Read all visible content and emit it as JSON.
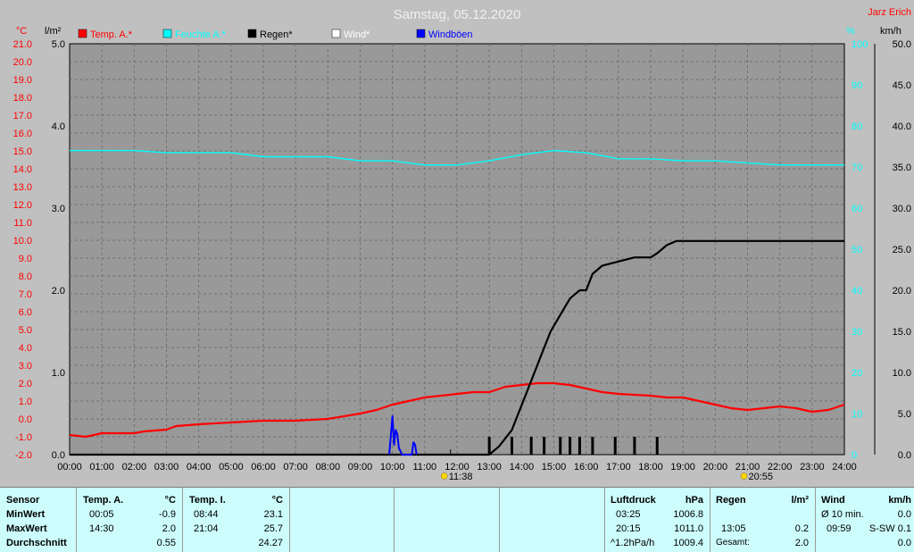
{
  "title": "Samstag, 05.12.2020",
  "author": "Jarz Erich",
  "legend": [
    {
      "label": "Temp. A.*",
      "color": "#ff0000"
    },
    {
      "label": "Feuchte A.*",
      "color": "#00ffff"
    },
    {
      "label": "Regen*",
      "color": "#000000"
    },
    {
      "label": "Wind*",
      "color": "#ffffff"
    },
    {
      "label": "Windböen",
      "color": "#0000ff"
    }
  ],
  "axes": {
    "temp_unit": "°C",
    "rain_unit": "l/m²",
    "hum_unit": "%",
    "wind_unit": "km/h",
    "temp_ticks": [
      "21.0",
      "20.0",
      "19.0",
      "18.0",
      "17.0",
      "16.0",
      "15.0",
      "14.0",
      "13.0",
      "12.0",
      "11.0",
      "10.0",
      "9.0",
      "8.0",
      "7.0",
      "6.0",
      "5.0",
      "4.0",
      "3.0",
      "2.0",
      "1.0",
      "0.0",
      "-1.0",
      "-2.0"
    ],
    "rain_ticks": [
      "5.0",
      "4.0",
      "3.0",
      "2.0",
      "1.0",
      "0.0"
    ],
    "hum_ticks": [
      "100",
      "90",
      "80",
      "70",
      "60",
      "50",
      "40",
      "30",
      "20",
      "10",
      "0"
    ],
    "wind_ticks": [
      "50.0",
      "45.0",
      "40.0",
      "35.0",
      "30.0",
      "25.0",
      "20.0",
      "15.0",
      "10.0",
      "5.0",
      "0.0"
    ],
    "x_ticks": [
      "00:00",
      "01:00",
      "02:00",
      "03:00",
      "04:00",
      "05:00",
      "06:00",
      "07:00",
      "08:00",
      "09:00",
      "10:00",
      "11:00",
      "12:00",
      "13:00",
      "14:00",
      "15:00",
      "16:00",
      "17:00",
      "18:00",
      "19:00",
      "20:00",
      "21:00",
      "22:00",
      "23:00",
      "24:00"
    ],
    "sunrise": "11:38",
    "sunset": "20:55"
  },
  "chart_data": {
    "type": "line",
    "title": "Samstag, 05.12.2020",
    "x_unit": "hour",
    "xlim": [
      0,
      24
    ],
    "series": [
      {
        "name": "Temp. A.*",
        "axis": "°C",
        "ylim": [
          -2,
          21
        ],
        "color": "#ff0000",
        "x": [
          0,
          0.5,
          1,
          2,
          2.3,
          3,
          3.3,
          4,
          5,
          6,
          7,
          8,
          9,
          9.5,
          10,
          10.5,
          11,
          11.5,
          12,
          12.5,
          13,
          13.5,
          14,
          14.5,
          15,
          15.5,
          16,
          16.5,
          17,
          18,
          18.5,
          19,
          19.5,
          20,
          20.5,
          21,
          21.5,
          22,
          22.5,
          23,
          23.5,
          24
        ],
        "y": [
          -0.9,
          -1.0,
          -0.8,
          -0.8,
          -0.7,
          -0.6,
          -0.4,
          -0.3,
          -0.2,
          -0.1,
          -0.1,
          0.0,
          0.3,
          0.5,
          0.8,
          1.0,
          1.2,
          1.3,
          1.4,
          1.5,
          1.5,
          1.8,
          1.9,
          2.0,
          2.0,
          1.9,
          1.7,
          1.5,
          1.4,
          1.3,
          1.2,
          1.2,
          1.0,
          0.8,
          0.6,
          0.5,
          0.6,
          0.7,
          0.6,
          0.4,
          0.5,
          0.8
        ]
      },
      {
        "name": "Feuchte A.*",
        "axis": "%",
        "ylim": [
          0,
          100
        ],
        "color": "#00ffff",
        "x": [
          0,
          1,
          2,
          3,
          4,
          5,
          6,
          7,
          8,
          9,
          10,
          11,
          12,
          13,
          14,
          15,
          16,
          17,
          18,
          19,
          20,
          21,
          22,
          23,
          24
        ],
        "y": [
          74,
          74,
          74,
          73.5,
          73.5,
          73.5,
          72.5,
          72.5,
          72.5,
          71.5,
          71.5,
          70.5,
          70.5,
          71.5,
          73,
          74,
          73.5,
          72,
          72,
          71.5,
          71.5,
          71,
          70.5,
          70.5,
          70.5
        ]
      },
      {
        "name": "Regen*",
        "axis": "l/m²",
        "ylim": [
          0,
          5
        ],
        "color": "#000000",
        "x": [
          0,
          13.0,
          13.3,
          13.5,
          13.7,
          13.9,
          14.1,
          14.3,
          14.5,
          14.7,
          14.9,
          15.2,
          15.5,
          15.8,
          16.0,
          16.2,
          16.5,
          17.0,
          17.5,
          18.0,
          18.2,
          18.5,
          18.8,
          19.0,
          19.5,
          20,
          21,
          22,
          23,
          24
        ],
        "y": [
          0,
          0,
          0.1,
          0.2,
          0.3,
          0.5,
          0.7,
          0.9,
          1.1,
          1.3,
          1.5,
          1.7,
          1.9,
          2.0,
          2.0,
          2.2,
          2.3,
          2.35,
          2.4,
          2.4,
          2.45,
          2.55,
          2.6,
          2.6,
          2.6,
          2.6,
          2.6,
          2.6,
          2.6,
          2.6
        ]
      },
      {
        "name": "Windböen",
        "axis": "km/h",
        "ylim": [
          0,
          50
        ],
        "color": "#0000ff",
        "x": [
          9.9,
          10.0,
          10.05,
          10.1,
          10.15,
          10.2,
          10.3,
          10.6,
          10.65,
          10.7,
          10.75
        ],
        "y": [
          0,
          4.7,
          1.2,
          3.0,
          2.5,
          0.8,
          0,
          0,
          1.5,
          1.2,
          0
        ]
      }
    ],
    "rain_bars_x": [
      13.0,
      13.7,
      14.3,
      14.7,
      15.2,
      15.5,
      15.8,
      16.2,
      16.9,
      17.5,
      18.2
    ],
    "wind_bars_x": [
      11.8
    ]
  },
  "stats": {
    "headers": {
      "sensor": "Sensor",
      "temp_a": "Temp. A.",
      "temp_a_unit": "°C",
      "temp_i": "Temp. I.",
      "temp_i_unit": "°C",
      "pressure": "Luftdruck",
      "pressure_unit": "hPa",
      "rain": "Regen",
      "rain_unit": "l/m²",
      "wind": "Wind",
      "wind_unit": "km/h"
    },
    "rows": {
      "min": "MinWert",
      "max": "MaxWert",
      "avg": "Durchschnitt"
    },
    "temp_a": {
      "min_time": "00:05",
      "min": "-0.9",
      "max_time": "14:30",
      "max": "2.0",
      "avg": "0.55"
    },
    "temp_i": {
      "min_time": "08:44",
      "min": "23.1",
      "max_time": "21:04",
      "max": "25.7",
      "avg": "24.27"
    },
    "pressure": {
      "min_time": "03:25",
      "min": "1006.8",
      "max_time": "20:15",
      "max": "1011.0",
      "trend_label": "^1.2hPa/h",
      "trend_value": "1009.4"
    },
    "rain": {
      "time": "13:05",
      "value": "0.2",
      "total_label": "Gesamt:",
      "total": "2.0"
    },
    "wind": {
      "avg_label": "Ø 10 min.",
      "avg": "0.0",
      "max_time": "09:59",
      "max": "S-SW 0.1",
      "cur": "0.0"
    }
  }
}
